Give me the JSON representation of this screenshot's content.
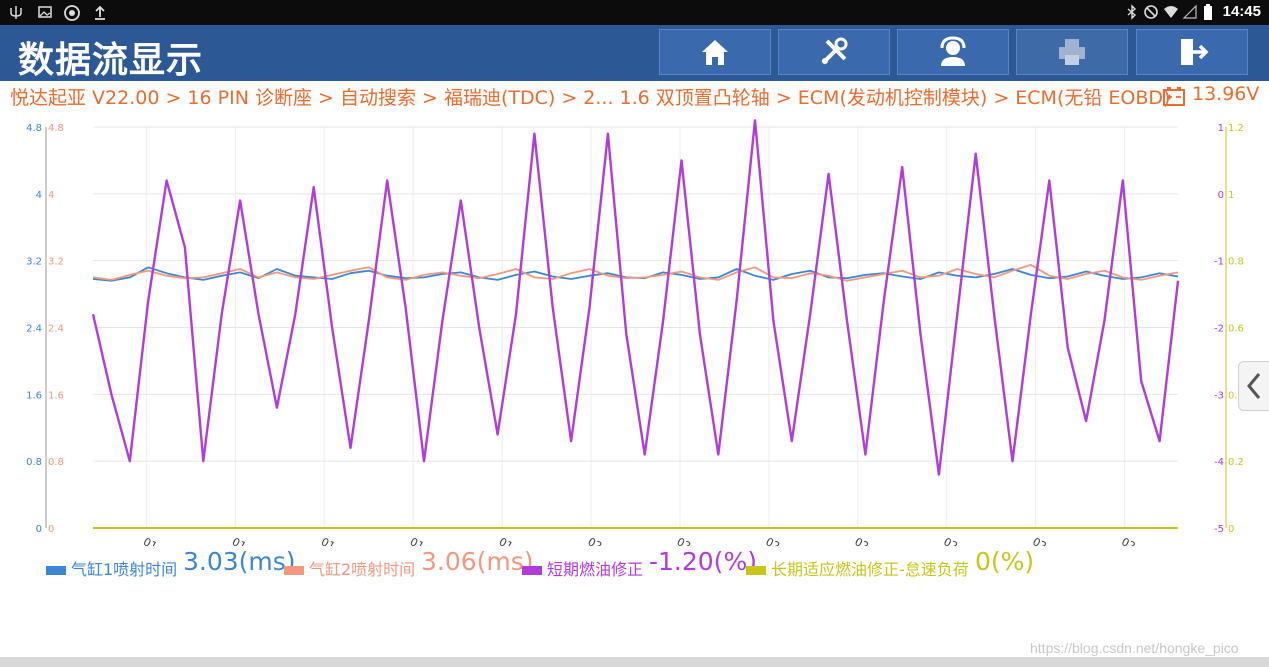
{
  "status_bar": {
    "time": "14:45",
    "left_icons": [
      "usb-icon",
      "image-icon",
      "gear-icon",
      "upload-icon"
    ],
    "right_icons": [
      "bluetooth-icon",
      "do-not-disturb-icon",
      "wifi-icon",
      "signal-icon",
      "battery-icon"
    ]
  },
  "header": {
    "title": "数据流显示",
    "buttons": [
      "home-icon",
      "diagnostics-tools-icon",
      "support-agent-icon",
      "printer-icon",
      "exit-icon"
    ]
  },
  "breadcrumb": {
    "text": "悦达起亚 V22.00 > 16 PIN 诊断座 > 自动搜索 > 福瑞迪(TDC) > 2... 1.6 双顶置凸轮轴 > ECM(发动机控制模块) > ECM(无铅 EOBD)",
    "voltage": "13.96V"
  },
  "colors": {
    "blue": "#3d86d6",
    "salmon": "#f2987e",
    "purple": "#b23be0",
    "olive": "#c9c61a",
    "title_bar": "#2d5896",
    "breadcrumb": "#ec6b2d"
  },
  "chart_data": {
    "type": "line",
    "x_ticks": [
      "01:35",
      "01:40",
      "01:45",
      "01:50",
      "01:55",
      "02:00",
      "02:05",
      "02:10",
      "02:15",
      "02:20",
      "02:25",
      "02:30"
    ],
    "x_range": [
      "01:32",
      "02:33"
    ],
    "left_axis_blue": {
      "ticks": [
        "0",
        "0.8",
        "1.6",
        "2.4",
        "3.2",
        "4",
        "4.8"
      ],
      "ylim": [
        0,
        4.8
      ]
    },
    "left_axis_salmon": {
      "ticks": [
        "0",
        "0.8",
        "1.6",
        "2.4",
        "3.2",
        "4",
        "4.8"
      ],
      "ylim": [
        0,
        4.8
      ]
    },
    "right_axis_purple": {
      "ticks": [
        "-5",
        "-4",
        "-3",
        "-2",
        "-1",
        "0",
        "1"
      ],
      "ylim": [
        -5,
        1
      ]
    },
    "right_axis_olive": {
      "ticks": [
        "0",
        "0.2",
        "0.4",
        "0.6",
        "0.8",
        "1",
        "1.2"
      ],
      "ylim": [
        0,
        1.2
      ]
    },
    "grid": true,
    "series": [
      {
        "name": "气缸1喷射时间",
        "current": "3.03(ms)",
        "color": "#3d86d6",
        "axis": "left",
        "ylim": [
          0,
          4.8
        ],
        "values": [
          2.98,
          2.96,
          3.0,
          3.12,
          3.05,
          3.0,
          2.97,
          3.02,
          3.06,
          2.99,
          3.1,
          3.02,
          3.0,
          2.98,
          3.05,
          3.08,
          3.02,
          2.99,
          3.0,
          3.04,
          3.06,
          3.0,
          2.97,
          3.03,
          3.07,
          3.01,
          2.98,
          3.02,
          3.05,
          3.0,
          2.99,
          3.06,
          3.03,
          2.98,
          3.0,
          3.1,
          3.02,
          2.97,
          3.04,
          3.08,
          3.0,
          2.99,
          3.03,
          3.05,
          3.01,
          2.98,
          3.06,
          3.02,
          3.0,
          3.04,
          3.1,
          3.03,
          2.99,
          3.01,
          3.07,
          3.02,
          2.98,
          3.0,
          3.05,
          3.01
        ]
      },
      {
        "name": "气缸2喷射时间",
        "current": "3.06(ms)",
        "color": "#f2987e",
        "axis": "left",
        "ylim": [
          0,
          4.8
        ],
        "values": [
          3.0,
          2.97,
          3.03,
          3.08,
          3.02,
          2.99,
          3.0,
          3.05,
          3.1,
          3.0,
          3.06,
          3.0,
          2.98,
          3.03,
          3.08,
          3.12,
          3.0,
          2.97,
          3.03,
          3.06,
          3.02,
          2.99,
          3.04,
          3.1,
          3.0,
          2.98,
          3.05,
          3.1,
          3.02,
          2.99,
          3.0,
          3.03,
          3.07,
          3.0,
          2.97,
          3.06,
          3.12,
          3.0,
          2.99,
          3.05,
          3.02,
          2.96,
          3.0,
          3.04,
          3.08,
          3.0,
          3.02,
          3.1,
          3.04,
          3.0,
          3.08,
          3.15,
          3.02,
          2.98,
          3.04,
          3.08,
          3.0,
          2.97,
          3.02,
          3.06
        ]
      },
      {
        "name": "短期燃油修正",
        "current": "-1.20(%)",
        "color": "#b23be0",
        "axis": "right",
        "ylim": [
          -5,
          1
        ],
        "values": [
          -1.8,
          -3.0,
          -4.0,
          -1.6,
          0.2,
          -0.8,
          -4.0,
          -1.8,
          -0.1,
          -1.8,
          -3.2,
          -1.8,
          0.1,
          -2.0,
          -3.8,
          -1.9,
          0.2,
          -1.7,
          -4.0,
          -1.9,
          -0.1,
          -2.0,
          -3.6,
          -1.8,
          0.9,
          -1.7,
          -3.7,
          -1.7,
          0.9,
          -2.1,
          -3.9,
          -1.9,
          0.5,
          -2.1,
          -3.9,
          -1.6,
          1.1,
          -1.9,
          -3.7,
          -1.8,
          0.3,
          -1.9,
          -3.9,
          -1.6,
          0.4,
          -2.1,
          -4.2,
          -1.8,
          0.6,
          -1.8,
          -4.0,
          -1.8,
          0.2,
          -2.3,
          -3.4,
          -1.9,
          0.2,
          -2.8,
          -3.7,
          -1.3
        ]
      },
      {
        "name": "长期适应燃油修正-怠速负荷",
        "current": "0(%)",
        "color": "#c9c61a",
        "axis": "right",
        "ylim": [
          0,
          1.2
        ],
        "values": [
          0,
          0,
          0,
          0,
          0,
          0,
          0,
          0,
          0,
          0,
          0,
          0
        ]
      }
    ]
  },
  "watermark": "https://blog.csdn.net/hongke_pico"
}
